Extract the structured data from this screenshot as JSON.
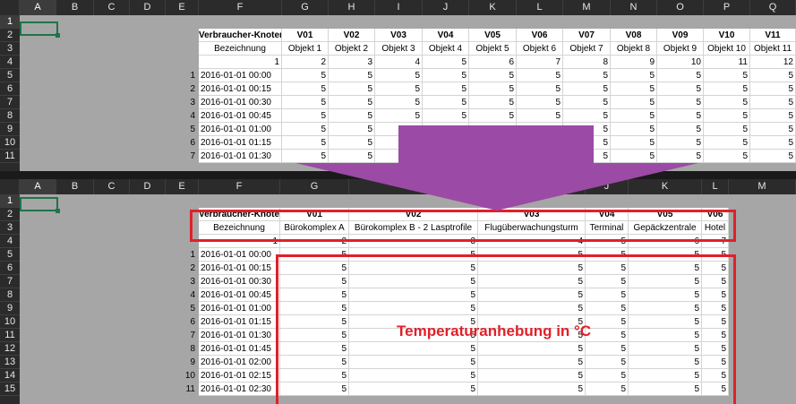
{
  "top_sheet": {
    "columns": [
      "A",
      "B",
      "C",
      "D",
      "E",
      "F",
      "G",
      "H",
      "I",
      "J",
      "K",
      "L",
      "M",
      "N",
      "O",
      "P",
      "Q"
    ],
    "rows": [
      "1",
      "2",
      "3",
      "4",
      "5",
      "6",
      "7",
      "8",
      "9",
      "10",
      "11"
    ],
    "row2": {
      "label": "Verbraucher-Knoten",
      "values": [
        "V01",
        "V02",
        "V03",
        "V04",
        "V05",
        "V06",
        "V07",
        "V08",
        "V09",
        "V10",
        "V11"
      ]
    },
    "row3": {
      "label": "Bezeichnung",
      "values": [
        "Objekt 1",
        "Objekt 2",
        "Objekt 3",
        "Objekt 4",
        "Objekt 5",
        "Objekt 6",
        "Objekt 7",
        "Objekt 8",
        "Objekt 9",
        "Objekt 10",
        "Objekt 11"
      ]
    },
    "row4": {
      "values": [
        "1",
        "2",
        "3",
        "4",
        "5",
        "6",
        "7",
        "8",
        "9",
        "10",
        "11",
        "12"
      ]
    },
    "data_rows": [
      {
        "n": "1",
        "t": "2016-01-01 00:00"
      },
      {
        "n": "2",
        "t": "2016-01-01 00:15"
      },
      {
        "n": "3",
        "t": "2016-01-01 00:30"
      },
      {
        "n": "4",
        "t": "2016-01-01 00:45"
      },
      {
        "n": "5",
        "t": "2016-01-01 01:00"
      },
      {
        "n": "6",
        "t": "2016-01-01 01:15"
      },
      {
        "n": "7",
        "t": "2016-01-01 01:30"
      }
    ],
    "cell_value": "5"
  },
  "bottom_sheet": {
    "columns": [
      "A",
      "B",
      "C",
      "D",
      "E",
      "F",
      "G",
      "H",
      "I",
      "J",
      "K",
      "L",
      "M"
    ],
    "rows": [
      "1",
      "2",
      "3",
      "4",
      "5",
      "6",
      "7",
      "8",
      "9",
      "10",
      "11",
      "12",
      "13",
      "14",
      "15"
    ],
    "row2": {
      "label": "Verbraucher-Knoten",
      "values": [
        "V01",
        "V02",
        "V03",
        "V04",
        "V05",
        "V06"
      ]
    },
    "row3": {
      "label": "Bezeichnung",
      "values": [
        "Bürokomplex A",
        "Bürokomplex B - 2 Lasptrofile",
        "Flugüberwachungsturm",
        "Terminal",
        "Gepäckzentrale",
        "Hotel"
      ]
    },
    "row4": {
      "values": [
        "1",
        "2",
        "3",
        "4",
        "5",
        "6",
        "7"
      ]
    },
    "data_rows": [
      {
        "n": "1",
        "t": "2016-01-01 00:00"
      },
      {
        "n": "2",
        "t": "2016-01-01 00:15"
      },
      {
        "n": "3",
        "t": "2016-01-01 00:30"
      },
      {
        "n": "4",
        "t": "2016-01-01 00:45"
      },
      {
        "n": "5",
        "t": "2016-01-01 01:00"
      },
      {
        "n": "6",
        "t": "2016-01-01 01:15"
      },
      {
        "n": "7",
        "t": "2016-01-01 01:30"
      },
      {
        "n": "8",
        "t": "2016-01-01 01:45"
      },
      {
        "n": "9",
        "t": "2016-01-01 02:00"
      },
      {
        "n": "10",
        "t": "2016-01-01 02:15"
      },
      {
        "n": "11",
        "t": "2016-01-01 02:30"
      }
    ],
    "cell_value": "5"
  },
  "annotation": "Temperaturanhebung in °C",
  "colors": {
    "arrow": "#9b4aa5",
    "highlight": "#e0202a",
    "selection": "#217346"
  }
}
